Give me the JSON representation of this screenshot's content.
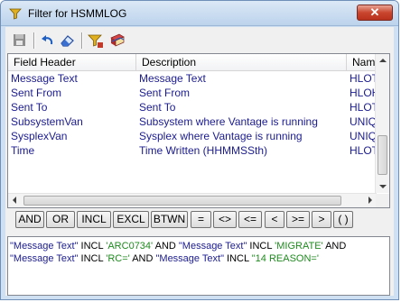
{
  "window": {
    "title": "Filter for HSMMLOG",
    "close_label": "✕"
  },
  "toolbar": {
    "buttons": [
      "save-icon",
      "undo-icon",
      "eraser-icon",
      "filter-icon",
      "books-icon"
    ]
  },
  "grid": {
    "columns": [
      "Field Header",
      "Description",
      "Name"
    ],
    "rows": [
      {
        "field": "Message Text",
        "desc": "Message Text",
        "name": "HLOT"
      },
      {
        "field": "Sent From",
        "desc": "Sent From",
        "name": "HLOH"
      },
      {
        "field": "Sent To",
        "desc": "Sent To",
        "name": "HLOT"
      },
      {
        "field": "SubsystemVan",
        "desc": "Subsystem where Vantage is running",
        "name": "UNIQ"
      },
      {
        "field": "SysplexVan",
        "desc": "Sysplex where Vantage is running",
        "name": "UNIQ"
      },
      {
        "field": "Time",
        "desc": "Time Written (HHMMSSth)",
        "name": "HLOT"
      }
    ]
  },
  "operators": [
    "AND",
    "OR",
    "INCL",
    "EXCL",
    "BTWN",
    "=",
    "<>",
    "<=",
    "<",
    ">=",
    ">",
    "( )"
  ],
  "expression": {
    "p1": "\"Message Text\"",
    "p2": " INCL ",
    "p3": "'ARC0734'",
    "p4": " AND ",
    "p5": "\"Message Text\"",
    "p6": " INCL ",
    "p7": "'MIGRATE'",
    "p8": " AND ",
    "p9": "\"Message Text\"",
    "p10": " INCL ",
    "p11": "'RC='",
    "p12": " AND ",
    "p13": "\"Message Text\"",
    "p14": "  INCL ",
    "p15": "\"14 REASON='"
  },
  "colors": {
    "field_text": "#1b1b8f",
    "string_literal": "#1f8a1f",
    "close_button": "#c9452e"
  }
}
